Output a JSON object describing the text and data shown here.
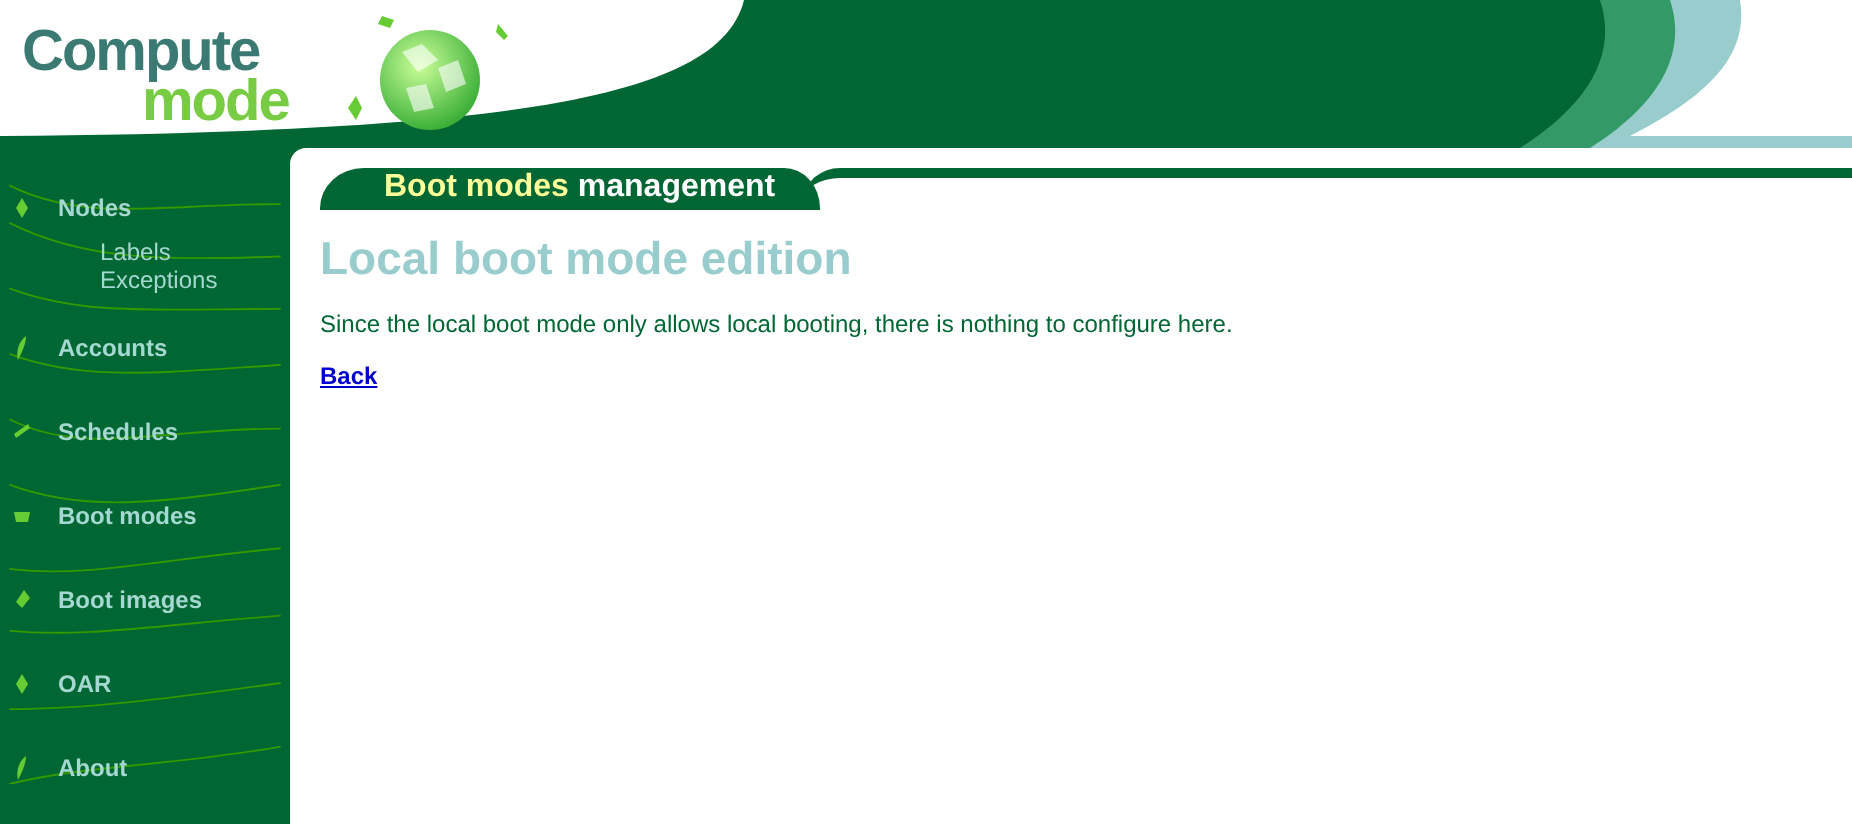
{
  "logo": {
    "line1": "Compute",
    "line2": "mode"
  },
  "sidebar": {
    "items": [
      {
        "label": "Nodes",
        "children": [
          {
            "label": "Labels"
          },
          {
            "label": "Exceptions"
          }
        ]
      },
      {
        "label": "Accounts"
      },
      {
        "label": "Schedules"
      },
      {
        "label": "Boot modes"
      },
      {
        "label": "Boot images"
      },
      {
        "label": "OAR"
      },
      {
        "label": "About"
      }
    ]
  },
  "section_title": {
    "highlight": "Boot modes",
    "rest": "management"
  },
  "page_title": "Local boot mode edition",
  "message": "Since the local boot mode only allows local booting, there is nothing to configure here.",
  "back_link": "Back"
}
